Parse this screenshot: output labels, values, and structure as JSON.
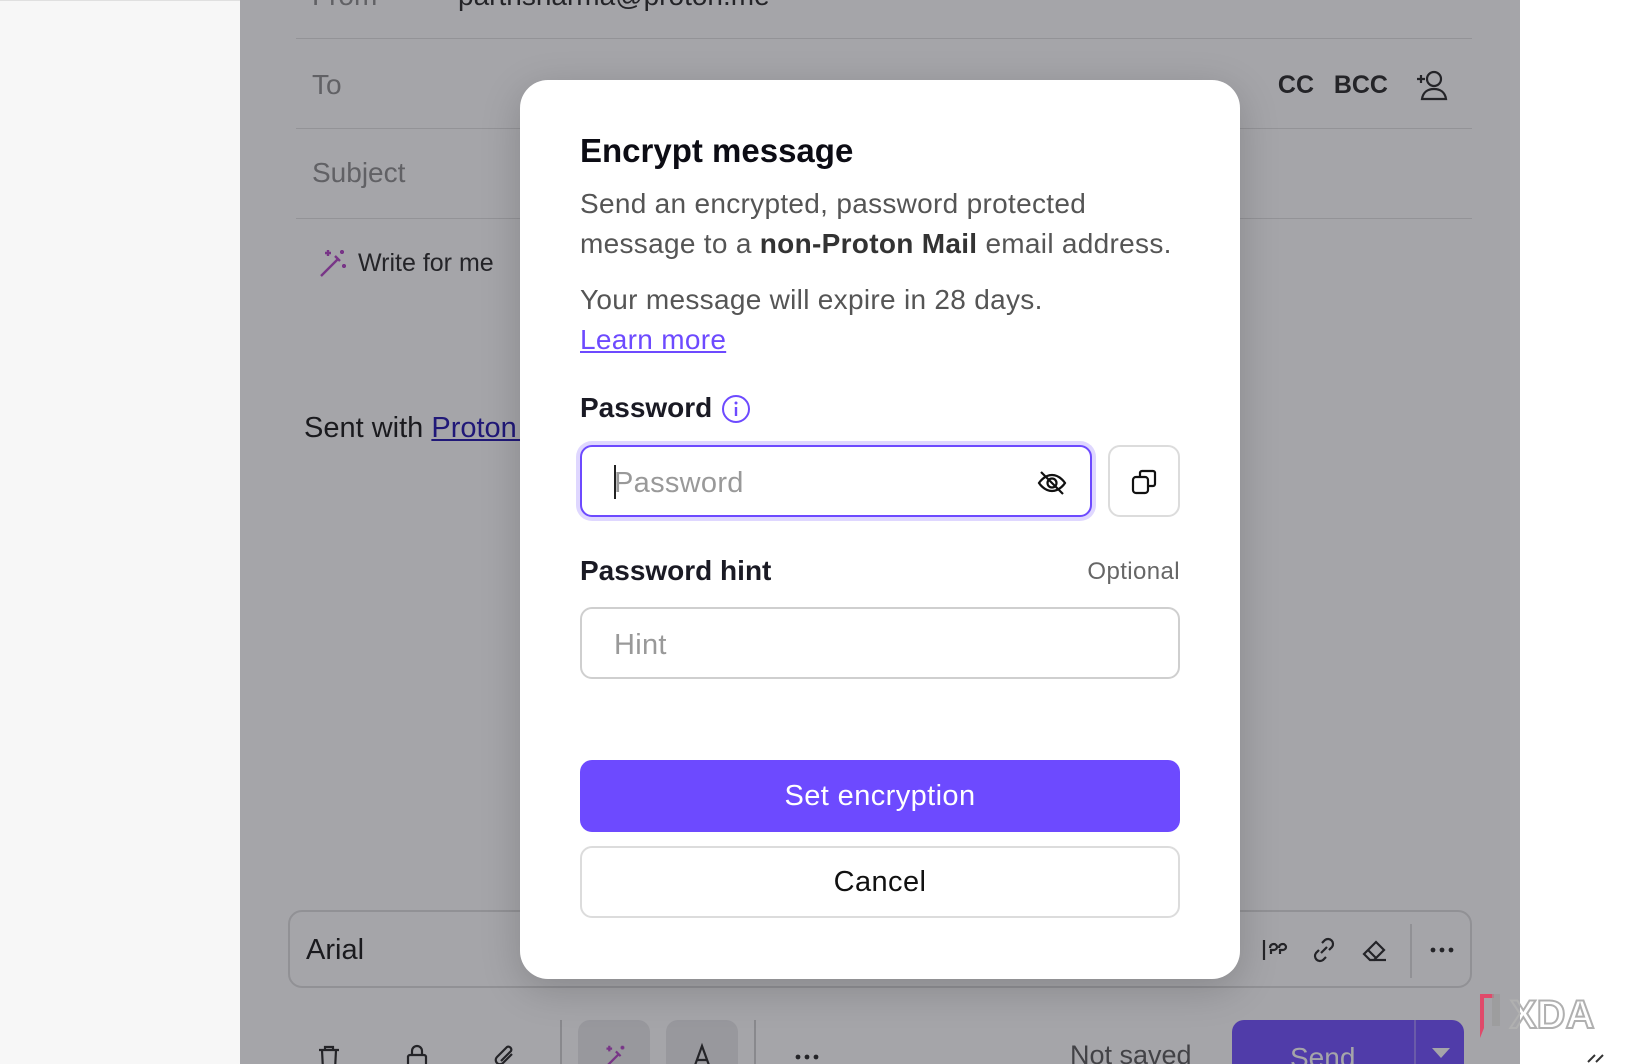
{
  "composer": {
    "from_label": "From",
    "from_value": "parthsharma@proton.me",
    "to_label": "To",
    "cc_label": "CC",
    "bcc_label": "BCC",
    "subject_label": "Subject",
    "write_for_me": "Write for me",
    "signature_prefix": "Sent with",
    "signature_link": "Proton Mail",
    "font_name": "Arial",
    "status": "Not saved",
    "send_label": "Send"
  },
  "modal": {
    "title": "Encrypt message",
    "desc_part1": "Send an encrypted, password protected message to a ",
    "desc_bold": "non-Proton Mail",
    "desc_part2": " email address.",
    "expire_text": "Your message will expire in 28 days.",
    "learn_more": "Learn more",
    "password_label": "Password",
    "password_placeholder": "Password",
    "hint_label": "Password hint",
    "hint_optional": "Optional",
    "hint_placeholder": "Hint",
    "set_button": "Set encryption",
    "cancel_button": "Cancel"
  },
  "watermark": {
    "text": "XDA"
  },
  "colors": {
    "accent": "#6d4aff",
    "overlay": "rgba(40,40,50,0.42)"
  }
}
